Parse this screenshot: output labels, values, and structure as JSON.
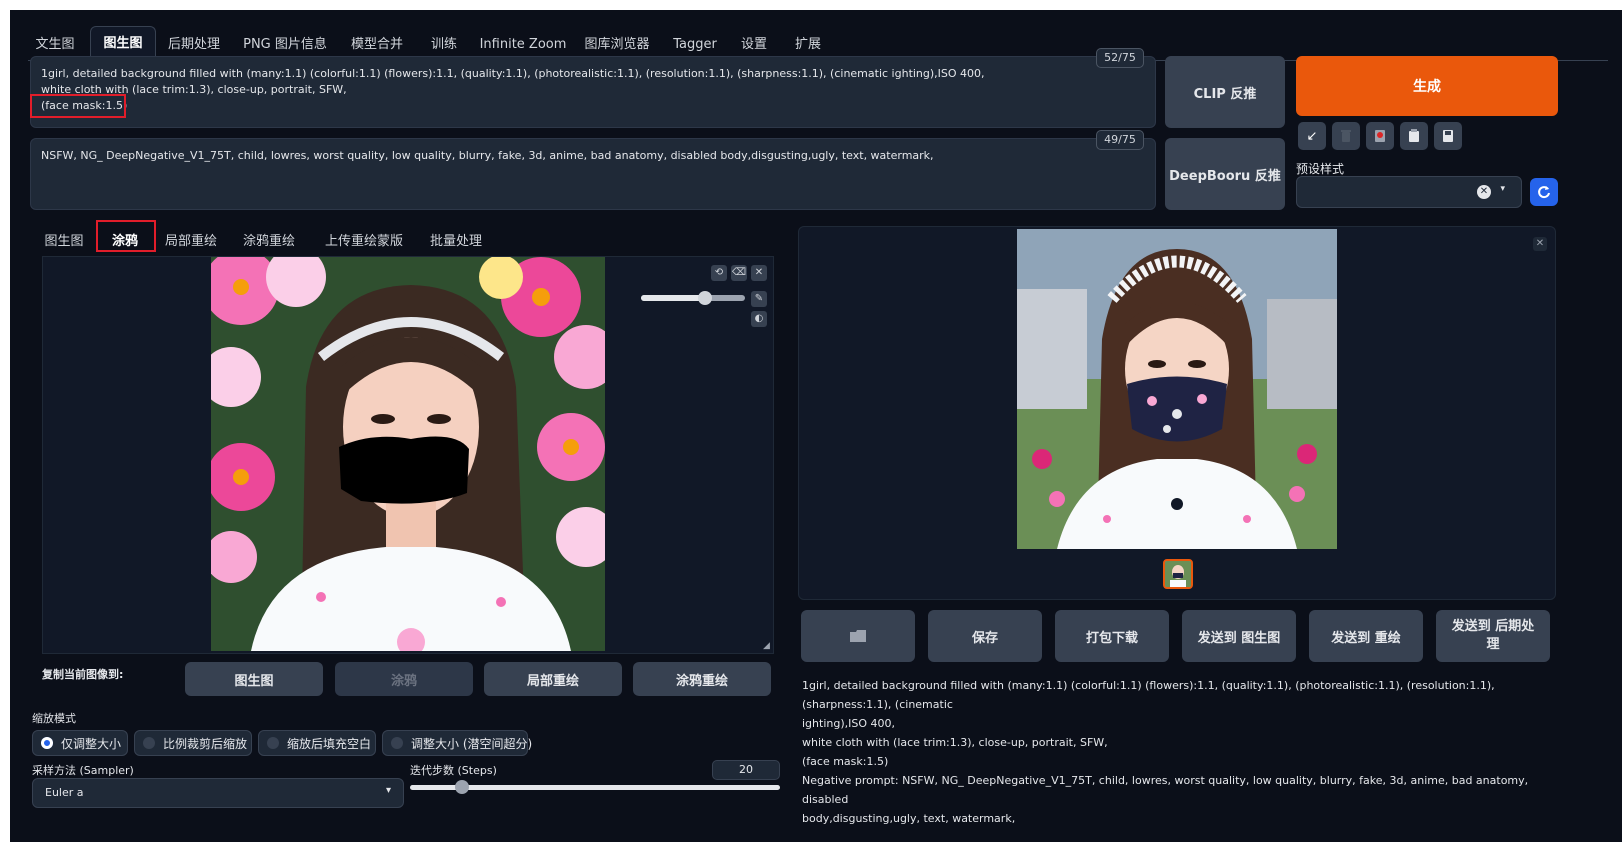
{
  "top_tabs": [
    "文生图",
    "图生图",
    "后期处理",
    "PNG 图片信息",
    "模型合并",
    "训练",
    "Infinite Zoom",
    "图库浏览器",
    "Tagger",
    "设置",
    "扩展"
  ],
  "prompt": {
    "line1": "1girl, detailed background filled with (many:1.1) (colorful:1.1) (flowers):1.1, (quality:1.1), (photorealistic:1.1), (resolution:1.1), (sharpness:1.1), (cinematic ighting),ISO 400,",
    "line2": "white cloth with (lace trim:1.3), close-up, portrait, SFW,",
    "line3": "(face mask:1.5)",
    "counter": "52/75"
  },
  "negative_prompt": {
    "text": "NSFW, NG_ DeepNegative_V1_75T, child, lowres, worst quality, low quality, blurry, fake, 3d, anime, bad anatomy, disabled body,disgusting,ugly, text, watermark,",
    "counter": "49/75"
  },
  "buttons": {
    "clip": "CLIP 反推",
    "deepbooru": "DeepBooru 反推",
    "generate": "生成",
    "preset_label": "预设样式"
  },
  "sub_tabs": [
    "图生图",
    "涂鸦",
    "局部重绘",
    "涂鸦重绘",
    "上传重绘蒙版",
    "批量处理"
  ],
  "copy_image": {
    "label": "复制当前图像到:",
    "buttons": [
      "图生图",
      "涂鸦",
      "局部重绘",
      "涂鸦重绘"
    ]
  },
  "resize": {
    "label": "缩放模式",
    "options": [
      "仅调整大小",
      "比例裁剪后缩放",
      "缩放后填充空白",
      "调整大小 (潜空间超分)"
    ],
    "selected": 0
  },
  "sampler": {
    "label": "采样方法 (Sampler)",
    "value": "Euler a"
  },
  "steps": {
    "label": "迭代步数 (Steps)",
    "value": "20",
    "fraction": 0.14
  },
  "brush_size_fraction": 0.62,
  "output_buttons": [
    "保存",
    "打包下载",
    "发送到 图生图",
    "发送到 重绘",
    "发送到 后期处理"
  ],
  "info": {
    "l1": "1girl, detailed background filled with (many:1.1) (colorful:1.1) (flowers):1.1, (quality:1.1), (photorealistic:1.1), (resolution:1.1), (sharpness:1.1), (cinematic",
    "l2": "ighting),ISO 400,",
    "l3": "white cloth with (lace trim:1.3), close-up, portrait, SFW,",
    "l4": "(face mask:1.5)",
    "l5": "Negative prompt: NSFW, NG_ DeepNegative_V1_75T, child, lowres, worst quality, low quality, blurry, fake, 3d, anime, bad anatomy, disabled",
    "l6": "body,disgusting,ugly, text, watermark,"
  },
  "icons": {
    "folder": "folder-icon",
    "close": "close-icon",
    "undo": "undo-icon",
    "eraser": "eraser-icon",
    "brush": "brush-icon",
    "palette": "palette-icon",
    "refresh": "refresh-icon"
  },
  "colors": {
    "accent": "#ea580c",
    "highlight": "#e11d2a",
    "background": "#0b0f19",
    "panel": "#1f2937"
  }
}
